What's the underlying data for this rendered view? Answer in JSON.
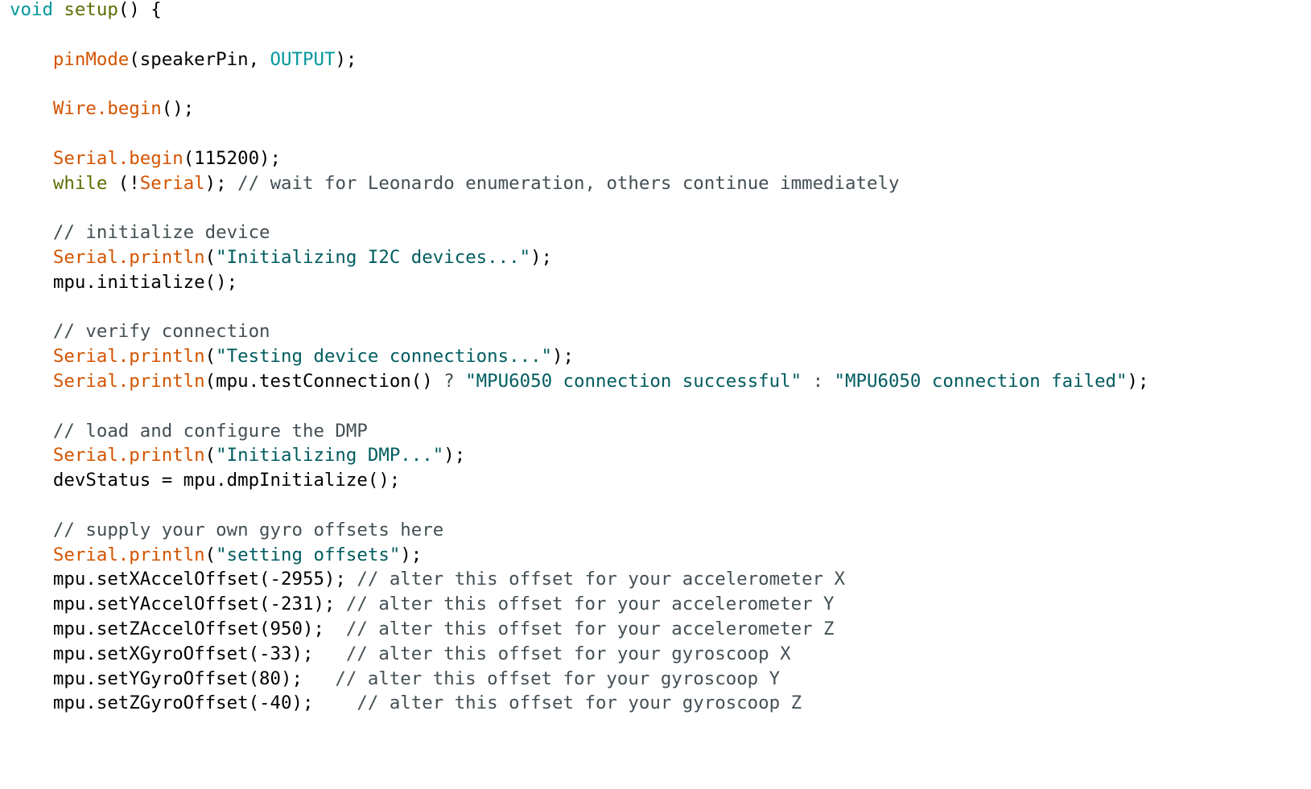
{
  "editor": {
    "lines": [
      [
        [
          "k",
          "void"
        ],
        [
          "p",
          " "
        ],
        [
          "f",
          "setup"
        ],
        [
          "p",
          "() {"
        ]
      ],
      [],
      [
        [
          "p",
          "    "
        ],
        [
          "o",
          "pinMode"
        ],
        [
          "p",
          "(speakerPin, "
        ],
        [
          "k",
          "OUTPUT"
        ],
        [
          "p",
          ");"
        ]
      ],
      [],
      [
        [
          "p",
          "    "
        ],
        [
          "o",
          "Wire.begin"
        ],
        [
          "p",
          "();"
        ]
      ],
      [],
      [
        [
          "p",
          "    "
        ],
        [
          "o",
          "Serial.begin"
        ],
        [
          "p",
          "(115200);"
        ]
      ],
      [
        [
          "p",
          "    "
        ],
        [
          "f",
          "while"
        ],
        [
          "p",
          " (!"
        ],
        [
          "o",
          "Serial"
        ],
        [
          "p",
          "); "
        ],
        [
          "c",
          "// wait for Leonardo enumeration, others continue immediately"
        ]
      ],
      [],
      [
        [
          "p",
          "    "
        ],
        [
          "c",
          "// initialize device"
        ]
      ],
      [
        [
          "p",
          "    "
        ],
        [
          "o",
          "Serial.println"
        ],
        [
          "p",
          "("
        ],
        [
          "s",
          "\"Initializing I2C devices...\""
        ],
        [
          "p",
          ");"
        ]
      ],
      [
        [
          "p",
          "    mpu.initialize();"
        ]
      ],
      [],
      [
        [
          "p",
          "    "
        ],
        [
          "c",
          "// verify connection"
        ]
      ],
      [
        [
          "p",
          "    "
        ],
        [
          "o",
          "Serial.println"
        ],
        [
          "p",
          "("
        ],
        [
          "s",
          "\"Testing device connections...\""
        ],
        [
          "p",
          ");"
        ]
      ],
      [
        [
          "p",
          "    "
        ],
        [
          "o",
          "Serial.println"
        ],
        [
          "p",
          "(mpu.testConnection() "
        ],
        [
          "c",
          "?"
        ],
        [
          "p",
          " "
        ],
        [
          "s",
          "\"MPU6050 connection successful\""
        ],
        [
          "p",
          " "
        ],
        [
          "c",
          ":"
        ],
        [
          "p",
          " "
        ],
        [
          "s",
          "\"MPU6050 connection failed\""
        ],
        [
          "p",
          ");"
        ]
      ],
      [],
      [
        [
          "p",
          "    "
        ],
        [
          "c",
          "// load and configure the DMP"
        ]
      ],
      [
        [
          "p",
          "    "
        ],
        [
          "o",
          "Serial.println"
        ],
        [
          "p",
          "("
        ],
        [
          "s",
          "\"Initializing DMP...\""
        ],
        [
          "p",
          ");"
        ]
      ],
      [
        [
          "p",
          "    devStatus = mpu.dmpInitialize();"
        ]
      ],
      [],
      [
        [
          "p",
          "    "
        ],
        [
          "c",
          "// supply your own gyro offsets here"
        ]
      ],
      [
        [
          "p",
          "    "
        ],
        [
          "o",
          "Serial.println"
        ],
        [
          "p",
          "("
        ],
        [
          "s",
          "\"setting offsets\""
        ],
        [
          "p",
          ");"
        ]
      ],
      [
        [
          "p",
          "    mpu.setXAccelOffset(-2955); "
        ],
        [
          "c",
          "// alter this offset for your accelerometer X"
        ]
      ],
      [
        [
          "p",
          "    mpu.setYAccelOffset(-231); "
        ],
        [
          "c",
          "// alter this offset for your accelerometer Y"
        ]
      ],
      [
        [
          "p",
          "    mpu.setZAccelOffset(950);  "
        ],
        [
          "c",
          "// alter this offset for your accelerometer Z"
        ]
      ],
      [
        [
          "p",
          "    mpu.setXGyroOffset(-33);   "
        ],
        [
          "c",
          "// alter this offset for your gyroscoop X"
        ]
      ],
      [
        [
          "p",
          "    mpu.setYGyroOffset(80);   "
        ],
        [
          "c",
          "// alter this offset for your gyroscoop Y"
        ]
      ],
      [
        [
          "p",
          "    mpu.setZGyroOffset(-40);    "
        ],
        [
          "c",
          "// alter this offset for your gyroscoop Z"
        ]
      ]
    ]
  },
  "colors": {
    "keyword": "#00979c",
    "function": "#5e6d03",
    "builtin": "#d35400",
    "string": "#005c5f",
    "comment": "#434f54"
  }
}
